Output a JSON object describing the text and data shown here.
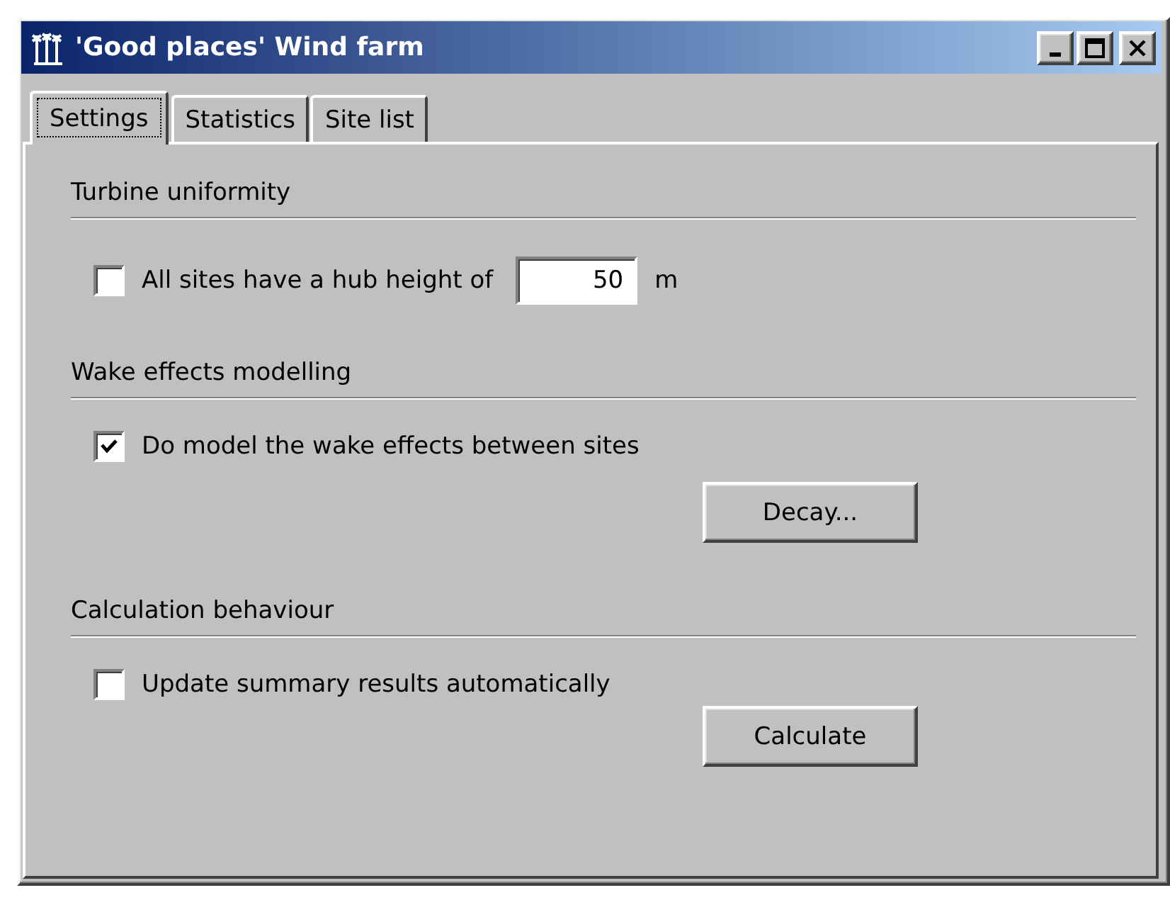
{
  "window": {
    "title": "'Good places' Wind farm"
  },
  "tabs": [
    {
      "label": "Settings",
      "selected": true
    },
    {
      "label": "Statistics",
      "selected": false
    },
    {
      "label": "Site list",
      "selected": false
    }
  ],
  "sections": [
    {
      "heading": "Turbine uniformity",
      "items": [
        {
          "kind": "checkfield",
          "label": "All sites have a hub height of",
          "checked": false,
          "value": "50",
          "unit": "m"
        }
      ]
    },
    {
      "heading": "Wake effects modelling",
      "items": [
        {
          "kind": "checkbox",
          "label": "Do model the wake effects between sites",
          "checked": true
        },
        {
          "kind": "button",
          "label": "Decay..."
        }
      ]
    },
    {
      "heading": "Calculation behaviour",
      "items": [
        {
          "kind": "checkbox",
          "label": "Update summary results automatically",
          "checked": false
        },
        {
          "kind": "button",
          "label": "Calculate"
        }
      ]
    }
  ]
}
